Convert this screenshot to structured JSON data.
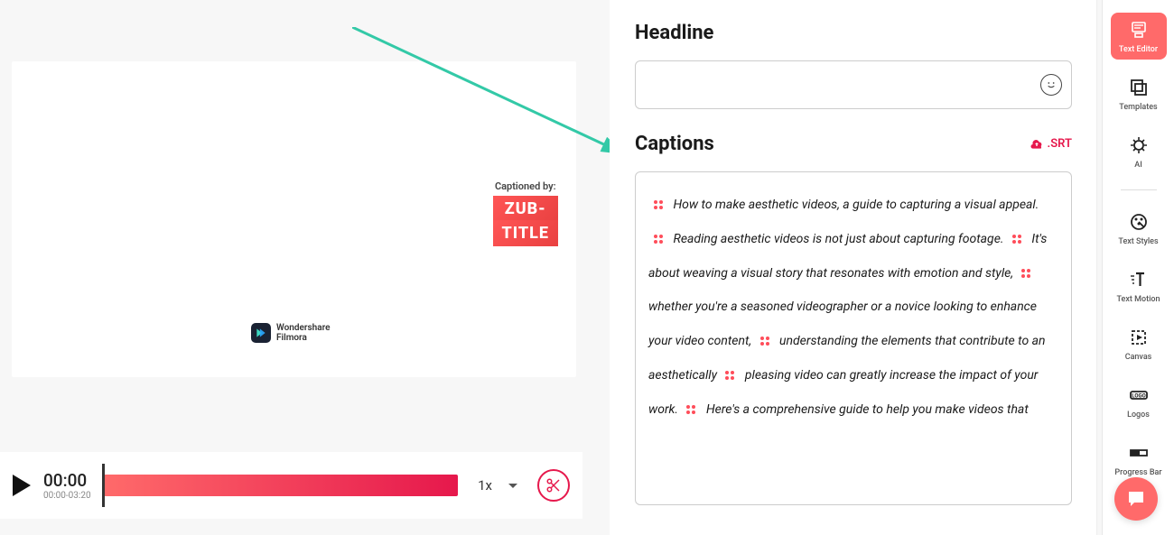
{
  "preview": {
    "captioned_by_label": "Captioned by:",
    "logo_line1": "ZUB-",
    "logo_line2": "TITLE",
    "watermark_line1": "Wondershare",
    "watermark_line2": "Filmora"
  },
  "playback": {
    "current_time": "00:00",
    "time_range": "00:00-03:20",
    "speed": "1x"
  },
  "editor": {
    "headline_label": "Headline",
    "captions_label": "Captions",
    "srt_label": ".SRT",
    "caption_segments": [
      "How to make aesthetic videos, a guide to capturing a visual appeal.",
      "Reading aesthetic videos is not just about capturing footage.",
      "It's about weaving a visual story that resonates with emotion and style,",
      "whether you're a seasoned videographer or a novice looking to enhance your video content,",
      "understanding the elements that contribute to an aesthetically",
      "pleasing video can greatly increase the impact of your work.",
      "Here's a comprehensive guide to help you make videos that"
    ]
  },
  "sidebar": {
    "items": [
      {
        "label": "Text Editor"
      },
      {
        "label": "Templates"
      },
      {
        "label": "AI"
      },
      {
        "label": "Text Styles"
      },
      {
        "label": "Text Motion"
      },
      {
        "label": "Canvas"
      },
      {
        "label": "Logos"
      },
      {
        "label": "Progress Bar"
      }
    ]
  }
}
